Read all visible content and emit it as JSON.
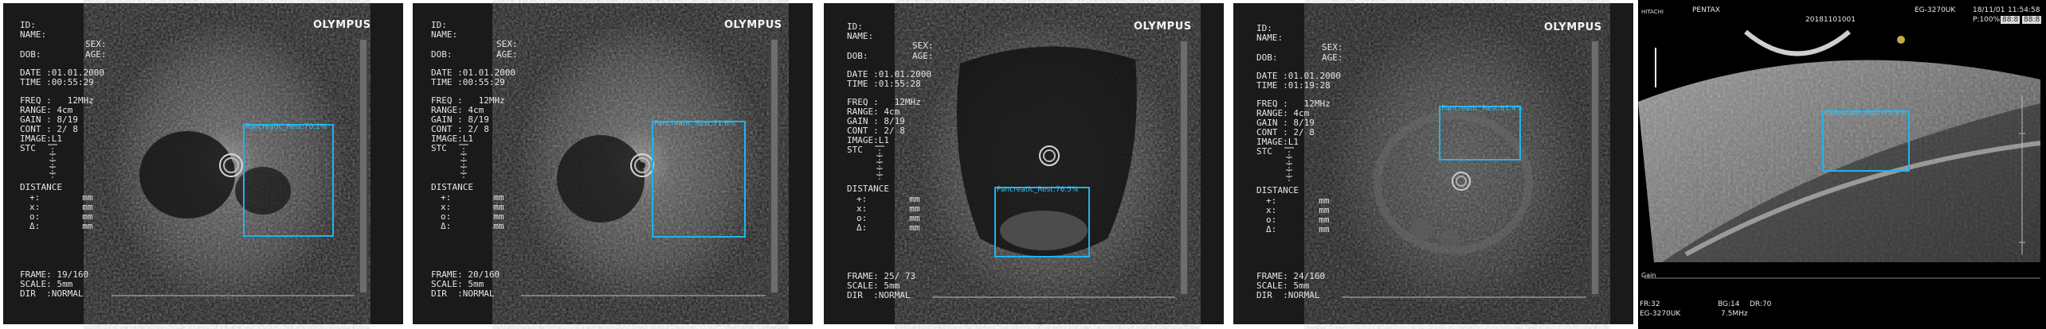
{
  "colors": {
    "frame": "#1a1a1a",
    "box": "#1fb4ee",
    "label": "#3fc2f0"
  },
  "panels": [
    {
      "logo": "OLYMPUS",
      "id": "ID:",
      "name": "NAME:",
      "sex": "SEX:",
      "dob": "DOB:",
      "age": "AGE:",
      "date": "DATE :01.01.2000",
      "time": "TIME :00:55:29",
      "freq": "FREQ :   12MHz",
      "range": "RANGE: 4cm",
      "gain": "GAIN : 8/19",
      "cont": "CONT : 2/ 8",
      "image": "IMAGE:L1",
      "stc": "STC",
      "distance": "DISTANCE",
      "distance_rows": [
        "+:        mm",
        "x:        mm",
        "o:        mm",
        "Δ:        mm"
      ],
      "frame_no": "FRAME: 19/160",
      "scale": "SCALE: 5mm",
      "dir": "DIR  :NORMAL",
      "label": "Pancreatic_Rest:70.1%"
    },
    {
      "logo": "OLYMPUS",
      "id": "ID:",
      "name": "NAME:",
      "sex": "SEX:",
      "dob": "DOB:",
      "age": "AGE:",
      "date": "DATE :01.01.2000",
      "time": "TIME :00:55:29",
      "freq": "FREQ :   12MHz",
      "range": "RANGE: 4cm",
      "gain": "GAIN : 8/19",
      "cont": "CONT : 2/ 8",
      "image": "IMAGE:L1",
      "stc": "STC",
      "distance": "DISTANCE",
      "distance_rows": [
        "+:        mm",
        "x:        mm",
        "o:        mm",
        "Δ:        mm"
      ],
      "frame_no": "FRAME: 20/160",
      "scale": "SCALE: 5mm",
      "dir": "DIR  :NORMAL",
      "label": "Pancreatic_Rest:71.6%"
    },
    {
      "logo": "OLYMPUS",
      "id": "ID:",
      "name": "NAME:",
      "sex": "SEX:",
      "dob": "DOB:",
      "age": "AGE:",
      "date": "DATE :01.01.2000",
      "time": "TIME :01:55:28",
      "freq": "FREQ :   12MHz",
      "range": "RANGE: 4cm",
      "gain": "GAIN : 8/19",
      "cont": "CONT : 2/ 8",
      "image": "IMAGE:L1",
      "stc": "STC",
      "distance": "DISTANCE",
      "distance_rows": [
        "+:        mm",
        "x:        mm",
        "o:        mm",
        "Δ:        mm"
      ],
      "frame_no": "FRAME: 25/ 73",
      "scale": "SCALE: 5mm",
      "dir": "DIR  :NORMAL",
      "label": "Pancreatic_Rest:76.5%"
    },
    {
      "logo": "OLYMPUS",
      "id": "ID:",
      "name": "NAME:",
      "sex": "SEX:",
      "dob": "DOB:",
      "age": "AGE:",
      "date": "DATE :01.01.2000",
      "time": "TIME :01:19:28",
      "freq": "FREQ :   12MHz",
      "range": "RANGE: 4cm",
      "gain": "GAIN : 8/19",
      "cont": "CONT : 2/ 8",
      "image": "IMAGE:L1",
      "stc": "STC",
      "distance": "DISTANCE",
      "distance_rows": [
        "+:        mm",
        "x:        mm",
        "o:        mm",
        "Δ:        mm"
      ],
      "frame_no": "FRAME: 24/160",
      "scale": "SCALE: 5mm",
      "dir": "DIR  :NORMAL",
      "label": "Pancreatic_Rest:81.4%"
    }
  ],
  "pentax": {
    "hitachi": "HITACHI",
    "brand": "PENTAX",
    "model": "EG-3270UK",
    "patient_no": "20181101001",
    "date": "18/11/01",
    "time": "11:54:58",
    "power": "P:100%",
    "box_a": "88:8",
    "box_b": "88:8",
    "label": "Pancreatic_Rest:75.5%",
    "side_label": "Gain",
    "fr": "FR:32",
    "eg": "EG-3270UK",
    "bg": "BG:14",
    "dr": "DR:70",
    "freq": "7.5MHz"
  }
}
